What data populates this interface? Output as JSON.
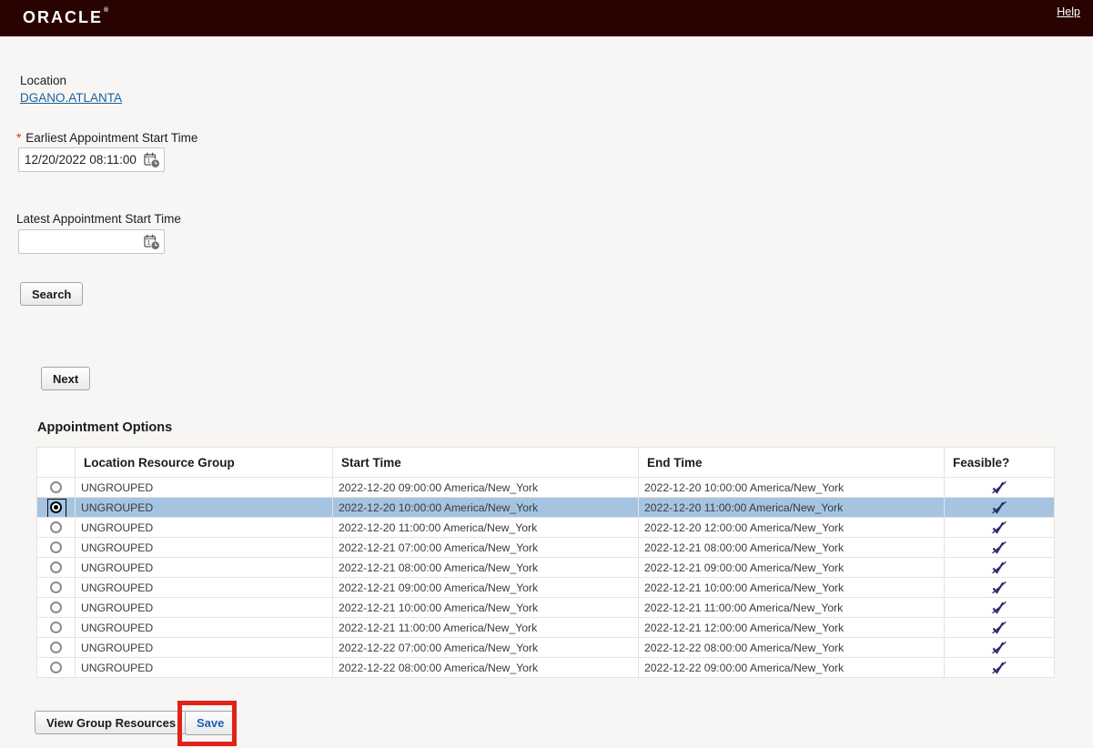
{
  "header": {
    "brand": "ORACLE",
    "reg_mark": "®",
    "help_label": "Help"
  },
  "location": {
    "label": "Location",
    "link": "DGANO.ATLANTA"
  },
  "fields": {
    "earliest": {
      "required_marker": "*",
      "label": "Earliest Appointment Start Time",
      "value": "12/20/2022 08:11:00"
    },
    "latest": {
      "label": "Latest Appointment Start Time",
      "value": ""
    }
  },
  "buttons": {
    "search": "Search",
    "next": "Next",
    "view_group_resources": "View Group Resources",
    "save": "Save"
  },
  "table": {
    "title": "Appointment Options",
    "columns": [
      "",
      "Location Resource Group",
      "Start Time",
      "End Time",
      "Feasible?"
    ],
    "feasible_icon": "crossed-check-icon",
    "rows": [
      {
        "selected": false,
        "group": "UNGROUPED",
        "start": "2022-12-20 09:00:00 America/New_York",
        "end": "2022-12-20 10:00:00 America/New_York"
      },
      {
        "selected": true,
        "group": "UNGROUPED",
        "start": "2022-12-20 10:00:00 America/New_York",
        "end": "2022-12-20 11:00:00 America/New_York"
      },
      {
        "selected": false,
        "group": "UNGROUPED",
        "start": "2022-12-20 11:00:00 America/New_York",
        "end": "2022-12-20 12:00:00 America/New_York"
      },
      {
        "selected": false,
        "group": "UNGROUPED",
        "start": "2022-12-21 07:00:00 America/New_York",
        "end": "2022-12-21 08:00:00 America/New_York"
      },
      {
        "selected": false,
        "group": "UNGROUPED",
        "start": "2022-12-21 08:00:00 America/New_York",
        "end": "2022-12-21 09:00:00 America/New_York"
      },
      {
        "selected": false,
        "group": "UNGROUPED",
        "start": "2022-12-21 09:00:00 America/New_York",
        "end": "2022-12-21 10:00:00 America/New_York"
      },
      {
        "selected": false,
        "group": "UNGROUPED",
        "start": "2022-12-21 10:00:00 America/New_York",
        "end": "2022-12-21 11:00:00 America/New_York"
      },
      {
        "selected": false,
        "group": "UNGROUPED",
        "start": "2022-12-21 11:00:00 America/New_York",
        "end": "2022-12-21 12:00:00 America/New_York"
      },
      {
        "selected": false,
        "group": "UNGROUPED",
        "start": "2022-12-22 07:00:00 America/New_York",
        "end": "2022-12-22 08:00:00 America/New_York"
      },
      {
        "selected": false,
        "group": "UNGROUPED",
        "start": "2022-12-22 08:00:00 America/New_York",
        "end": "2022-12-22 09:00:00 America/New_York"
      }
    ]
  },
  "colors": {
    "header_bg": "#290300",
    "selected_row": "#a5c4e2",
    "link_blue": "#19609d",
    "save_text_blue": "#1f5fb8",
    "annotation_red": "#e02318",
    "required_red": "#d9291c",
    "feasible_icon_navy": "#2b2b6b"
  }
}
